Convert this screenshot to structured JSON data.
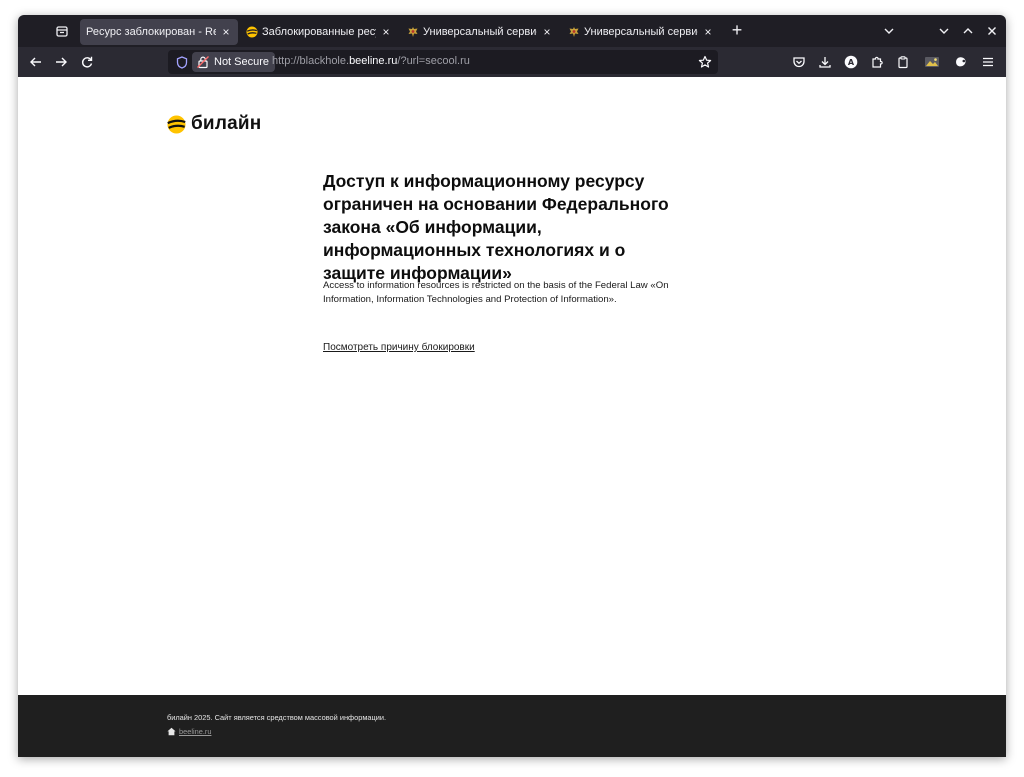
{
  "browser": {
    "tabs": [
      {
        "title": "Ресурс заблокирован - Resou",
        "active": true,
        "favicon": "blank-page-icon"
      },
      {
        "title": "Заблокированные ресурсы",
        "active": false,
        "favicon": "beeline-logo-icon"
      },
      {
        "title": "Универсальный сервис пр",
        "active": false,
        "favicon": "coat-of-arms-icon"
      },
      {
        "title": "Универсальный сервис пр",
        "active": false,
        "favicon": "coat-of-arms-icon"
      }
    ],
    "new_tab_label": "+",
    "tab_close_label": "×",
    "address": {
      "security_label": "Not Secure",
      "url_prefix": "http://blackhole.",
      "url_host": "beeline.ru",
      "url_suffix": "/?url=secool.ru"
    }
  },
  "page": {
    "logo_text": "билайн",
    "heading": "Доступ к информационному ресурсу ограничен на основании Федерального закона «Об информации, информационных технологиях и о защите информации»",
    "subtext": "Access to information resources is restricted on the basis of the Federal Law «On Information, Information Technologies and Protection of Information».",
    "reason_link": "Посмотреть причину блокировки"
  },
  "footer": {
    "copyright": "билайн 2025. Сайт является средством массовой информации.",
    "link": "beeline.ru"
  },
  "colors": {
    "tabstrip_bg": "#1f1e25",
    "navbar_bg": "#2b2a33",
    "active_tab_bg": "#42414d",
    "brand_yellow": "#ffc300",
    "footer_bg": "#1f1f1f"
  }
}
